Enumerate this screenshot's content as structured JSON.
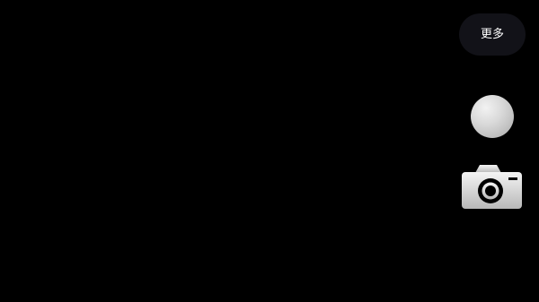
{
  "viewfinder": {
    "background": "#000000"
  },
  "controls": {
    "more_label": "更多",
    "shutter_icon": "shutter-circle",
    "camera_icon": "camera-icon"
  },
  "colors": {
    "more_bg": "#121218",
    "icon_light": "#f2f2f2",
    "icon_dark": "#a9a9a9"
  }
}
